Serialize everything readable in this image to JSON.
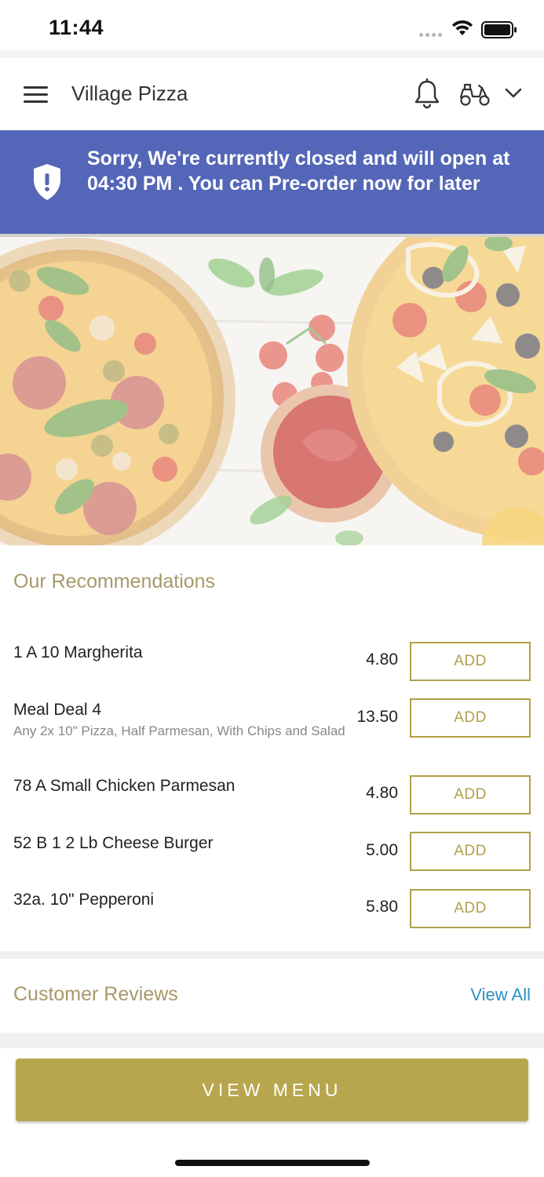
{
  "status_bar": {
    "time": "11:44"
  },
  "header": {
    "title": "Village Pizza"
  },
  "banner": {
    "text": "Sorry, We're currently closed and will open at 04:30 PM . You can Pre-order now for later"
  },
  "recommendations": {
    "title": "Our Recommendations",
    "add_label": "ADD",
    "items": [
      {
        "name": "1 A 10 Margherita",
        "price": "4.80",
        "description": ""
      },
      {
        "name": "Meal Deal 4",
        "price": "13.50",
        "description": "Any 2x 10\" Pizza, Half Parmesan, With Chips and Salad"
      },
      {
        "name": "78 A Small Chicken Parmesan",
        "price": "4.80",
        "description": ""
      },
      {
        "name": "52 B 1 2 Lb Cheese Burger",
        "price": "5.00",
        "description": ""
      },
      {
        "name": "32a. 10\" Pepperoni",
        "price": "5.80",
        "description": ""
      }
    ]
  },
  "reviews": {
    "title": "Customer Reviews",
    "view_all": "View All"
  },
  "footer": {
    "view_menu": "VIEW MENU"
  },
  "colors": {
    "banner": "#5466b7",
    "accent_gold": "#b8a64f",
    "link_blue": "#2a93c4",
    "section_title": "#a6996a"
  },
  "icons": [
    "menu-icon",
    "bell-icon",
    "scooter-icon",
    "chevron-down-icon",
    "shield-alert-icon",
    "wifi-icon",
    "battery-icon"
  ]
}
